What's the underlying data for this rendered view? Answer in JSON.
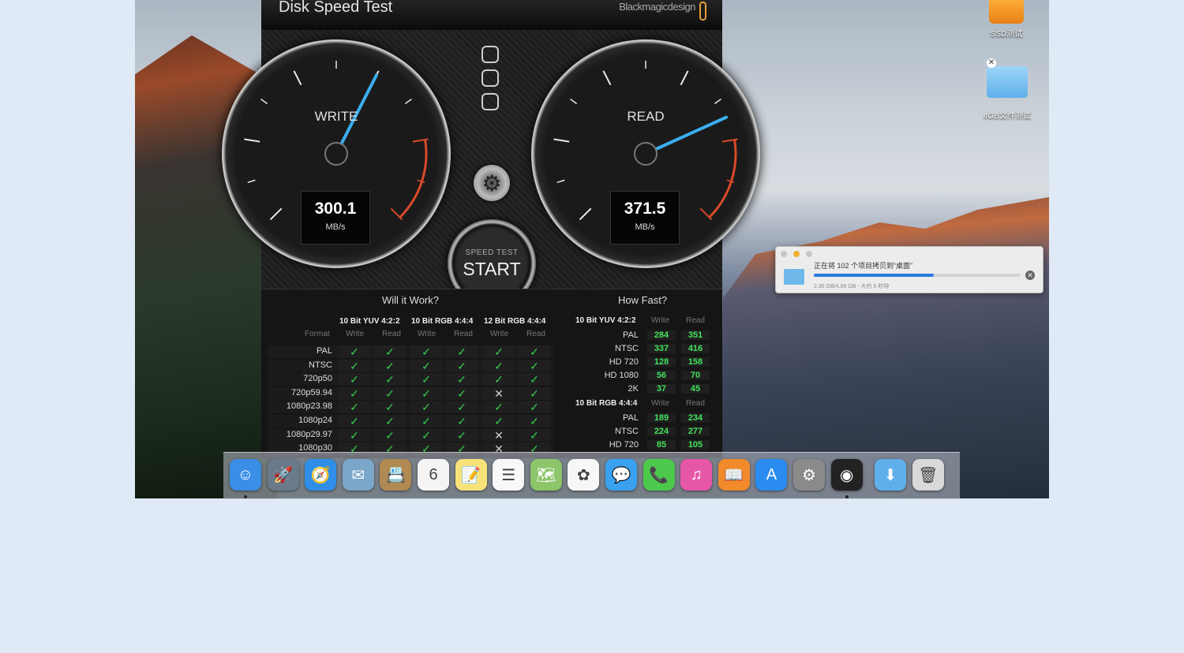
{
  "app": {
    "title": "Disk Speed Test",
    "brand": "Blackmagicdesign",
    "write": {
      "label": "WRITE",
      "value": "300.1",
      "unit": "MB/s",
      "mbps": 300.1
    },
    "read": {
      "label": "READ",
      "value": "371.5",
      "unit": "MB/s",
      "mbps": 371.5
    },
    "start": {
      "small": "SPEED TEST",
      "big": "START"
    },
    "will_it_work": {
      "title": "Will it Work?",
      "format_label": "Format",
      "groups": [
        "10 Bit YUV 4:2:2",
        "10 Bit RGB 4:4:4",
        "12 Bit RGB 4:4:4"
      ],
      "sub": [
        "Write",
        "Read"
      ],
      "rows": [
        {
          "format": "PAL",
          "marks": [
            "✓",
            "✓",
            "✓",
            "✓",
            "✓",
            "✓"
          ]
        },
        {
          "format": "NTSC",
          "marks": [
            "✓",
            "✓",
            "✓",
            "✓",
            "✓",
            "✓"
          ]
        },
        {
          "format": "720p50",
          "marks": [
            "✓",
            "✓",
            "✓",
            "✓",
            "✓",
            "✓"
          ]
        },
        {
          "format": "720p59.94",
          "marks": [
            "✓",
            "✓",
            "✓",
            "✓",
            "✕",
            "✓"
          ]
        },
        {
          "format": "1080p23.98",
          "marks": [
            "✓",
            "✓",
            "✓",
            "✓",
            "✓",
            "✓"
          ]
        },
        {
          "format": "1080p24",
          "marks": [
            "✓",
            "✓",
            "✓",
            "✓",
            "✓",
            "✓"
          ]
        },
        {
          "format": "1080p29.97",
          "marks": [
            "✓",
            "✓",
            "✓",
            "✓",
            "✕",
            "✓"
          ]
        },
        {
          "format": "1080p30",
          "marks": [
            "✓",
            "✓",
            "✓",
            "✓",
            "✕",
            "✓"
          ]
        }
      ]
    },
    "how_fast": {
      "title": "How Fast?",
      "sections": [
        {
          "name": "10 Bit YUV 4:2:2",
          "write_label": "Write",
          "read_label": "Read",
          "rows": [
            {
              "fmt": "PAL",
              "w": "284",
              "r": "351"
            },
            {
              "fmt": "NTSC",
              "w": "337",
              "r": "416"
            },
            {
              "fmt": "HD 720",
              "w": "128",
              "r": "158"
            },
            {
              "fmt": "HD 1080",
              "w": "56",
              "r": "70"
            },
            {
              "fmt": "2K",
              "w": "37",
              "r": "45"
            }
          ]
        },
        {
          "name": "10 Bit RGB 4:4:4",
          "write_label": "Write",
          "read_label": "Read",
          "rows": [
            {
              "fmt": "PAL",
              "w": "189",
              "r": "234"
            },
            {
              "fmt": "NTSC",
              "w": "224",
              "r": "277"
            },
            {
              "fmt": "HD 720",
              "w": "85",
              "r": "105"
            }
          ]
        }
      ]
    }
  },
  "desktop": {
    "items": [
      {
        "label": "SSD测试",
        "icon": "external-drive-icon"
      },
      {
        "label": "4GB文件测试",
        "icon": "folder-icon"
      }
    ]
  },
  "copy_dialog": {
    "text": "正在将 102 个项目拷贝到“桌面”",
    "sub": "2.36 GB/4.08 GB - 大约 5 秒钟",
    "progress": 0.58
  },
  "dock": {
    "apps": [
      {
        "name": "finder-icon",
        "glyph": "☺",
        "color": "#3a8ee6",
        "running": true
      },
      {
        "name": "launchpad-icon",
        "glyph": "🚀",
        "color": "#6a7a8a",
        "running": false
      },
      {
        "name": "safari-icon",
        "glyph": "🧭",
        "color": "#2f8fe8",
        "running": false
      },
      {
        "name": "mail-icon",
        "glyph": "✉",
        "color": "#7aa6c9",
        "running": false
      },
      {
        "name": "contacts-icon",
        "glyph": "📇",
        "color": "#b08a52",
        "running": false
      },
      {
        "name": "calendar-icon",
        "glyph": "6",
        "color": "#f4f4f4",
        "running": false
      },
      {
        "name": "notes-icon",
        "glyph": "📝",
        "color": "#f7e27a",
        "running": false
      },
      {
        "name": "reminders-icon",
        "glyph": "☰",
        "color": "#f8f8f8",
        "running": false
      },
      {
        "name": "maps-icon",
        "glyph": "🗺",
        "color": "#8cc56a",
        "running": false
      },
      {
        "name": "photos-icon",
        "glyph": "✿",
        "color": "#f7f7f7",
        "running": false
      },
      {
        "name": "messages-icon",
        "glyph": "💬",
        "color": "#3aa1f0",
        "running": false
      },
      {
        "name": "facetime-icon",
        "glyph": "📞",
        "color": "#4cc94c",
        "running": false
      },
      {
        "name": "itunes-icon",
        "glyph": "♫",
        "color": "#e657a8",
        "running": false
      },
      {
        "name": "ibooks-icon",
        "glyph": "📖",
        "color": "#f08a2a",
        "running": false
      },
      {
        "name": "app-store-icon",
        "glyph": "A",
        "color": "#2a8cf0",
        "running": false
      },
      {
        "name": "system-preferences-icon",
        "glyph": "⚙",
        "color": "#8a8a8a",
        "running": false
      },
      {
        "name": "disk-speed-test-icon",
        "glyph": "◉",
        "color": "#222222",
        "running": true
      },
      {
        "name": "downloads-folder-icon",
        "glyph": "⬇",
        "color": "#5fb0ea",
        "running": false
      },
      {
        "name": "trash-icon",
        "glyph": "🗑",
        "color": "#d9d9d9",
        "running": false
      }
    ]
  }
}
